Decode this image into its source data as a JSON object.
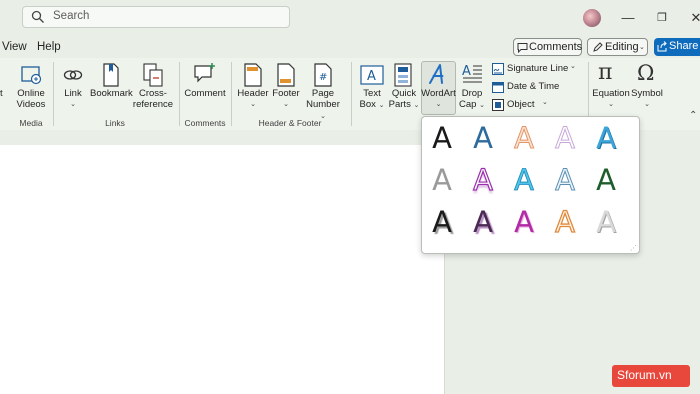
{
  "search": {
    "placeholder": "Search"
  },
  "window": {
    "minimize": "—",
    "maximize": "❐",
    "close": "✕"
  },
  "menu": {
    "items": [
      "View",
      "Help"
    ],
    "comments_label": "Comments",
    "editing_label": "Editing",
    "share_label": "Share"
  },
  "ribbon": {
    "media": {
      "online_videos": [
        "Online",
        "Videos"
      ],
      "group": "Media"
    },
    "links": {
      "link": "Link",
      "bookmark": "Bookmark",
      "cross_reference": [
        "Cross-",
        "reference"
      ],
      "group": "Links"
    },
    "comments": {
      "comment": "Comment",
      "group": "Comments"
    },
    "header_footer": {
      "header": "Header",
      "footer": "Footer",
      "page_number": [
        "Page",
        "Number"
      ],
      "group": "Header & Footer"
    },
    "text": {
      "text_box": [
        "Text",
        "Box"
      ],
      "quick_parts": [
        "Quick",
        "Parts"
      ],
      "wordart": "WordArt",
      "drop_cap": [
        "Drop",
        "Cap"
      ],
      "signature_line": "Signature Line",
      "date_time": "Date & Time",
      "object": "Object"
    },
    "symbols": {
      "equation": "Equation",
      "symbol": "Symbol"
    }
  },
  "wordart_styles": [
    {
      "glyph": "A",
      "style": "black-fill"
    },
    {
      "glyph": "A",
      "style": "blue-fill"
    },
    {
      "glyph": "A",
      "style": "orange-outline"
    },
    {
      "glyph": "A",
      "style": "pink-outline"
    },
    {
      "glyph": "A",
      "style": "blue-gradient"
    },
    {
      "glyph": "A",
      "style": "gray-fill"
    },
    {
      "glyph": "A",
      "style": "purple-outline-shadow"
    },
    {
      "glyph": "A",
      "style": "cyan-bevel"
    },
    {
      "glyph": "A",
      "style": "blue-outline"
    },
    {
      "glyph": "A",
      "style": "green-fill"
    },
    {
      "glyph": "A",
      "style": "black-shadow"
    },
    {
      "glyph": "A",
      "style": "purple-dark-shadow"
    },
    {
      "glyph": "A",
      "style": "magenta-fill"
    },
    {
      "glyph": "A",
      "style": "orange-double-outline"
    },
    {
      "glyph": "A",
      "style": "silver-fill"
    }
  ],
  "watermark": "Sforum.vn",
  "colors": {
    "accent": "#0f6cbd",
    "ribbon_bg": "#eef3ec",
    "watermark": "#e8473b"
  }
}
